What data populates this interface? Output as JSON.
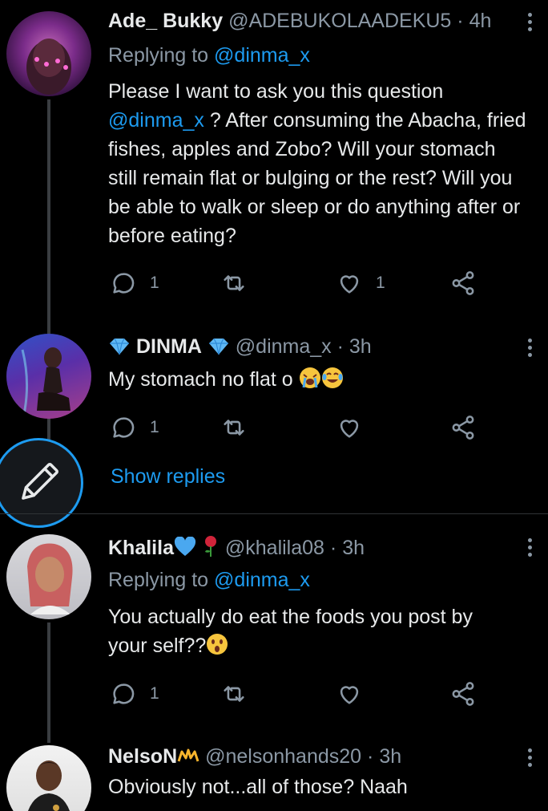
{
  "tweets": [
    {
      "name": "Ade_ Bukky",
      "handle": "@ADEBUKOLAADEKU5",
      "time": "4h",
      "replying_prefix": "Replying to",
      "replying_to": "@dinma_x",
      "text_before": "Please I want to ask you this question",
      "text_mention": "@dinma_x",
      "text_after": "? After consuming the Abacha, fried fishes, apples and Zobo? Will your stomach still remain flat or bulging or the rest? Will you be able to walk or sleep or do anything after or before eating?",
      "reply_count": "1",
      "retweet_count": "",
      "like_count": "1"
    },
    {
      "name": "DINMA",
      "handle": "@dinma_x",
      "time": "3h",
      "text": "My stomach no flat o",
      "reply_count": "1",
      "retweet_count": "",
      "like_count": ""
    },
    {
      "name": "Khalila",
      "handle": "@khalila08",
      "time": "3h",
      "replying_prefix": "Replying to",
      "replying_to": "@dinma_x",
      "text": "You actually do eat the foods you post by your self??",
      "reply_count": "1",
      "retweet_count": "",
      "like_count": ""
    },
    {
      "name": "NelsoN",
      "handle": "@nelsonhands20",
      "time": "3h",
      "text": "Obviously not...all of those? Naah"
    }
  ],
  "show_replies": "Show replies",
  "separator": "·",
  "icons": {
    "reply": "reply-icon",
    "retweet": "retweet-icon",
    "like": "heart-icon",
    "share": "share-icon",
    "compose": "compose-icon"
  },
  "colors": {
    "background": "#000000",
    "accent": "#1d9bf0",
    "muted": "#8b98a5",
    "text": "#e7e9ea",
    "thread_line": "#3a3d41"
  }
}
